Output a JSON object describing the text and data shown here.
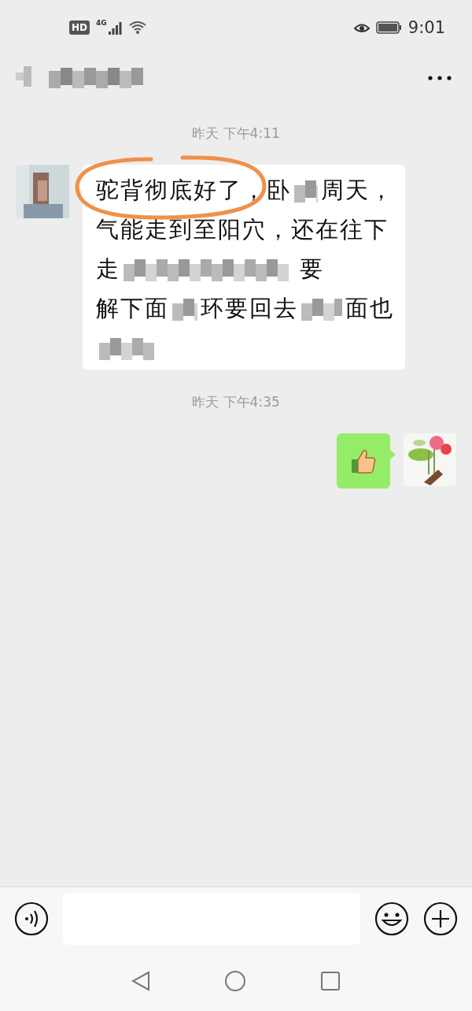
{
  "status_bar": {
    "hd": "HD",
    "network": "4G",
    "time": "9:01"
  },
  "messages": [
    {
      "kind": "time",
      "text": "昨天 下午4:11"
    },
    {
      "kind": "received",
      "lines": [
        [
          {
            "kind": "text",
            "text": "驼背彻底好了，卧"
          },
          {
            "kind": "blur"
          },
          {
            "kind": "text",
            "text": "周天，"
          }
        ],
        [
          {
            "kind": "text",
            "text": "气能走到至阳穴，还在往下"
          }
        ],
        [
          {
            "kind": "text",
            "text": "走"
          },
          {
            "kind": "blur"
          },
          {
            "kind": "text",
            "text": "要"
          }
        ],
        [
          {
            "kind": "text",
            "text": "解下面"
          },
          {
            "kind": "blur"
          },
          {
            "kind": "text",
            "text": "环要回去"
          },
          {
            "kind": "blur"
          },
          {
            "kind": "text",
            "text": "面也"
          }
        ],
        [
          {
            "kind": "blur"
          }
        ]
      ]
    },
    {
      "kind": "time",
      "text": "昨天 下午4:35"
    },
    {
      "kind": "sent_sticker"
    }
  ]
}
